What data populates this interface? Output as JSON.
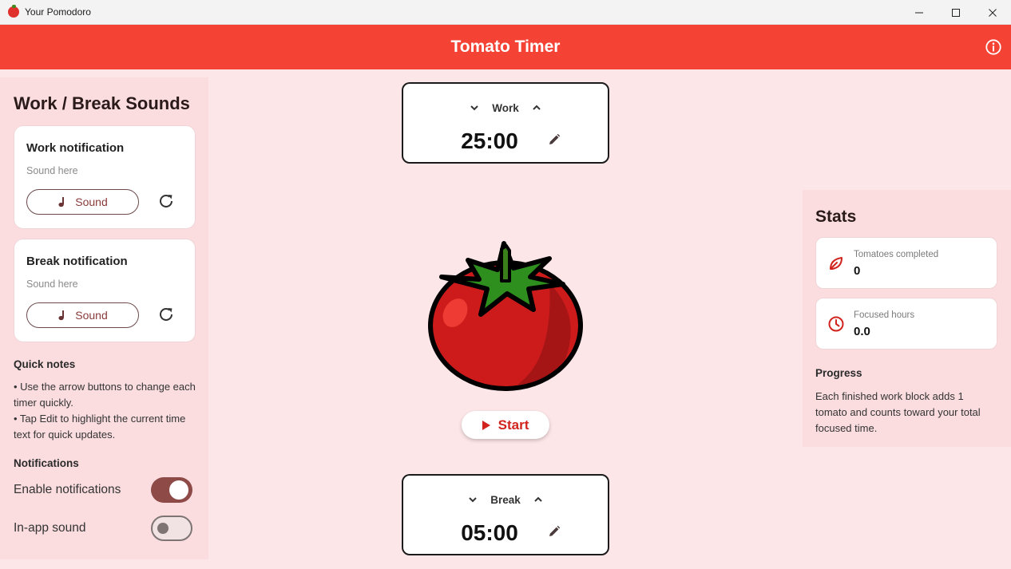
{
  "window": {
    "title": "Your Pomodoro"
  },
  "appbar": {
    "title": "Tomato Timer"
  },
  "sounds": {
    "heading": "Work / Break Sounds",
    "work": {
      "title": "Work notification",
      "subtitle": "Sound here",
      "button_label": "Sound"
    },
    "break": {
      "title": "Break notification",
      "subtitle": "Sound here",
      "button_label": "Sound"
    }
  },
  "quick_notes": {
    "title": "Quick notes",
    "items": [
      "• Use the arrow buttons to change each timer quickly.",
      "• Tap Edit to highlight the current time text for quick updates."
    ]
  },
  "notifications": {
    "title": "Notifications",
    "enable": {
      "label": "Enable notifications",
      "on": true
    },
    "in_app_sound": {
      "label": "In-app sound",
      "on": false
    }
  },
  "timers": {
    "work": {
      "label": "Work",
      "time": "25:00"
    },
    "break": {
      "label": "Break",
      "time": "05:00"
    }
  },
  "start": {
    "label": "Start"
  },
  "stats": {
    "heading": "Stats",
    "tomatoes": {
      "label": "Tomatoes completed",
      "value": "0"
    },
    "hours": {
      "label": "Focused hours",
      "value": "0.0"
    },
    "progress_title": "Progress",
    "progress_text": "Each finished work block adds 1 tomato and counts toward your total focused time."
  },
  "colors": {
    "appbar": "#f44335",
    "background": "#fde6e8",
    "panel": "#fbdde0",
    "accent": "#d1241e",
    "toggle_on": "#8e4a47"
  },
  "icons": {
    "app": "tomato-icon",
    "info": "info-icon",
    "music": "music-note-icon",
    "reset": "refresh-icon",
    "edit": "pencil-icon",
    "chevrons": [
      "chevron-down-icon",
      "chevron-up-icon"
    ],
    "play": "play-icon",
    "tomatoes_stat": "leaf-icon",
    "hours_stat": "clock-icon"
  }
}
